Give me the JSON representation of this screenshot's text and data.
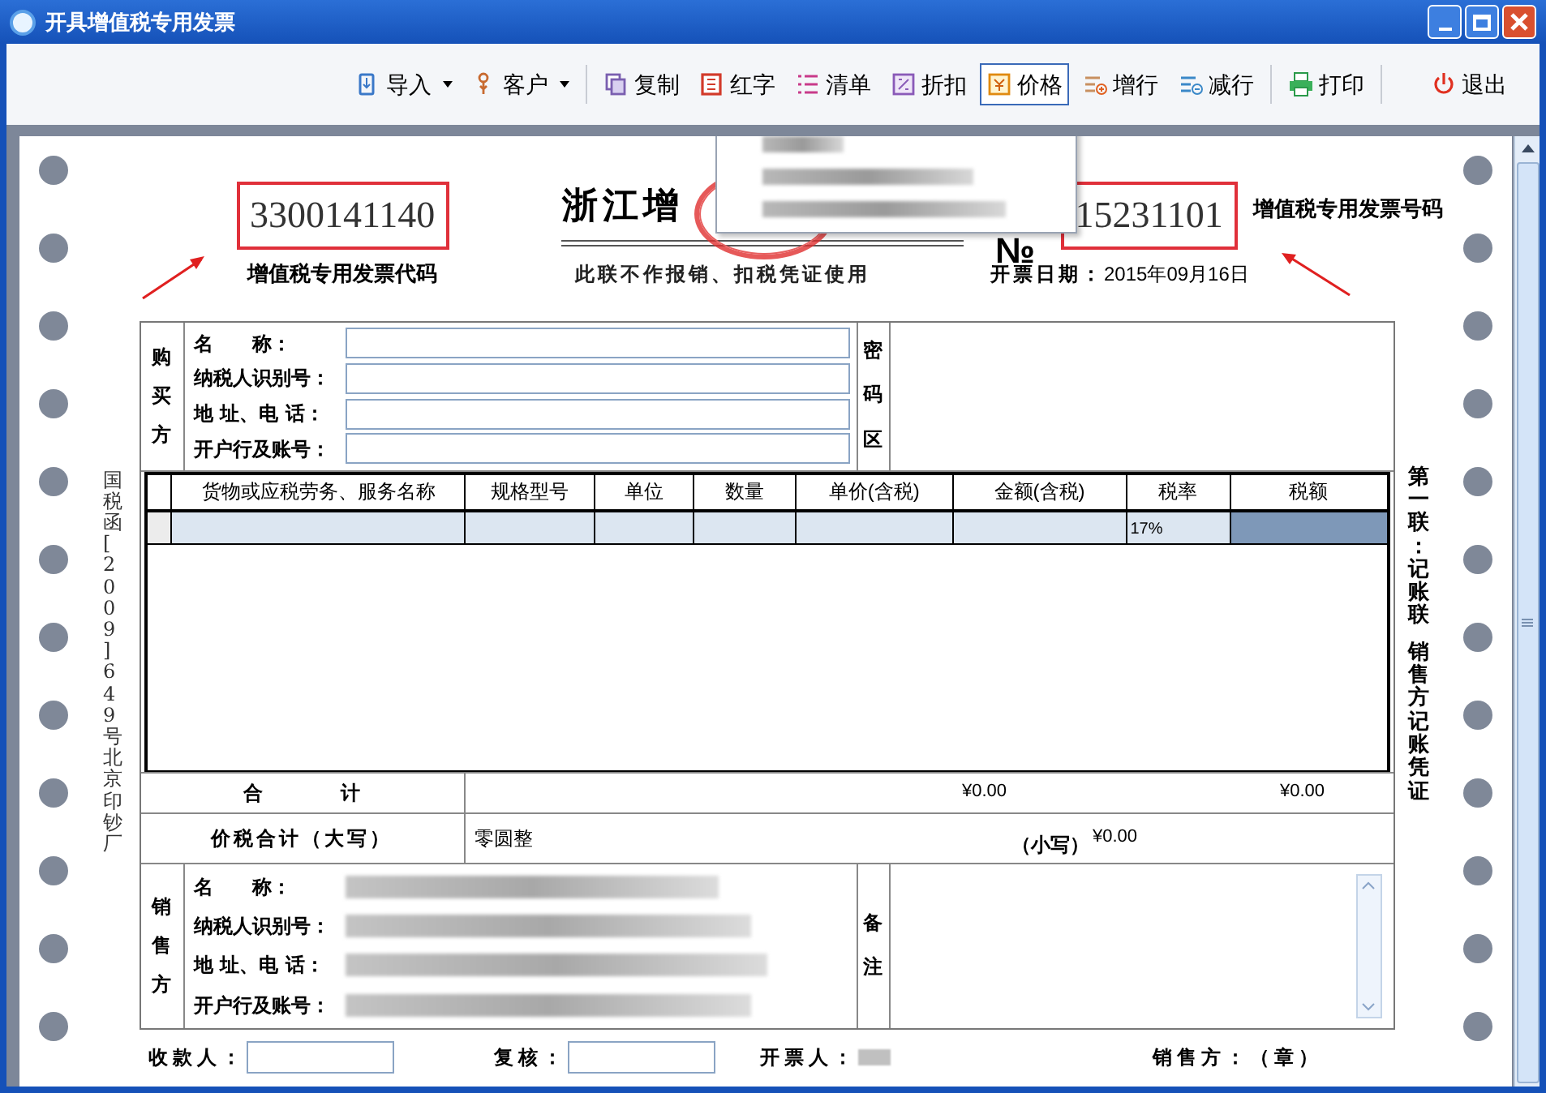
{
  "window": {
    "title": "开具增值税专用发票"
  },
  "toolbar": [
    {
      "label": "导入",
      "kind": "dropdown",
      "selected": false
    },
    {
      "label": "客户",
      "kind": "dropdown",
      "selected": false
    },
    {
      "label": "复制",
      "kind": "button",
      "selected": false
    },
    {
      "label": "红字",
      "kind": "button",
      "selected": false
    },
    {
      "label": "清单",
      "kind": "button",
      "selected": false
    },
    {
      "label": "折扣",
      "kind": "button",
      "selected": false
    },
    {
      "label": "价格",
      "kind": "button",
      "selected": true
    },
    {
      "label": "增行",
      "kind": "button",
      "selected": false
    },
    {
      "label": "减行",
      "kind": "button",
      "selected": false
    },
    {
      "label": "打印",
      "kind": "button",
      "selected": false
    },
    {
      "label": "退出",
      "kind": "button",
      "selected": false
    }
  ],
  "invoice": {
    "title": "浙江增",
    "code": "3300141140",
    "code_note": "增值税专用发票代码",
    "number_sign": "№",
    "number": "15231101",
    "number_note": "增值税专用发票号码",
    "notice": "此联不作报销、扣税凭证使用",
    "date_label": "开票日期：",
    "date": "2015年09月16日",
    "side_left": "国税函[2009]649号北京印钞厂",
    "side_right": [
      "第一联：记账联",
      "销售方记账凭证"
    ]
  },
  "buyer": {
    "heading": "购买方",
    "fields": [
      "名　　称：",
      "纳税人识别号：",
      "地 址、电 话：",
      "开户行及账号："
    ],
    "password_heading": "密码区"
  },
  "goods": {
    "columns": [
      "货物或应税劳务、服务名称",
      "规格型号",
      "单位",
      "数量",
      "单价(含税)",
      "金额(含税)",
      "税率",
      "税额"
    ],
    "rows": [
      {
        "cells": [
          {
            "selected": false
          },
          {
            "selected": false
          },
          {
            "selected": false
          },
          {
            "selected": false
          },
          {
            "selected": false
          },
          {
            "selected": false
          },
          {
            "selected": false
          },
          {
            "text": "17%",
            "selected": false
          },
          {
            "selected": true
          }
        ]
      }
    ]
  },
  "totals": {
    "label": "合　　　　计",
    "amount": "¥0.00",
    "tax": "¥0.00"
  },
  "grand_total": {
    "label": "价税合计（大写）",
    "words": "零圆整",
    "small_label": "（小写）",
    "small": "¥0.00"
  },
  "seller": {
    "heading": "销售方",
    "fields": [
      "名　　称：",
      "纳税人识别号：",
      "地 址、电 话：",
      "开户行及账号："
    ],
    "remarks_heading": "备注"
  },
  "footer": [
    {
      "label": "收款人：",
      "kind": "field"
    },
    {
      "label": "复核：",
      "kind": "field"
    },
    {
      "label": "开票人：",
      "kind": "blurred"
    },
    {
      "label": "销售方：（章）",
      "kind": "text"
    }
  ]
}
